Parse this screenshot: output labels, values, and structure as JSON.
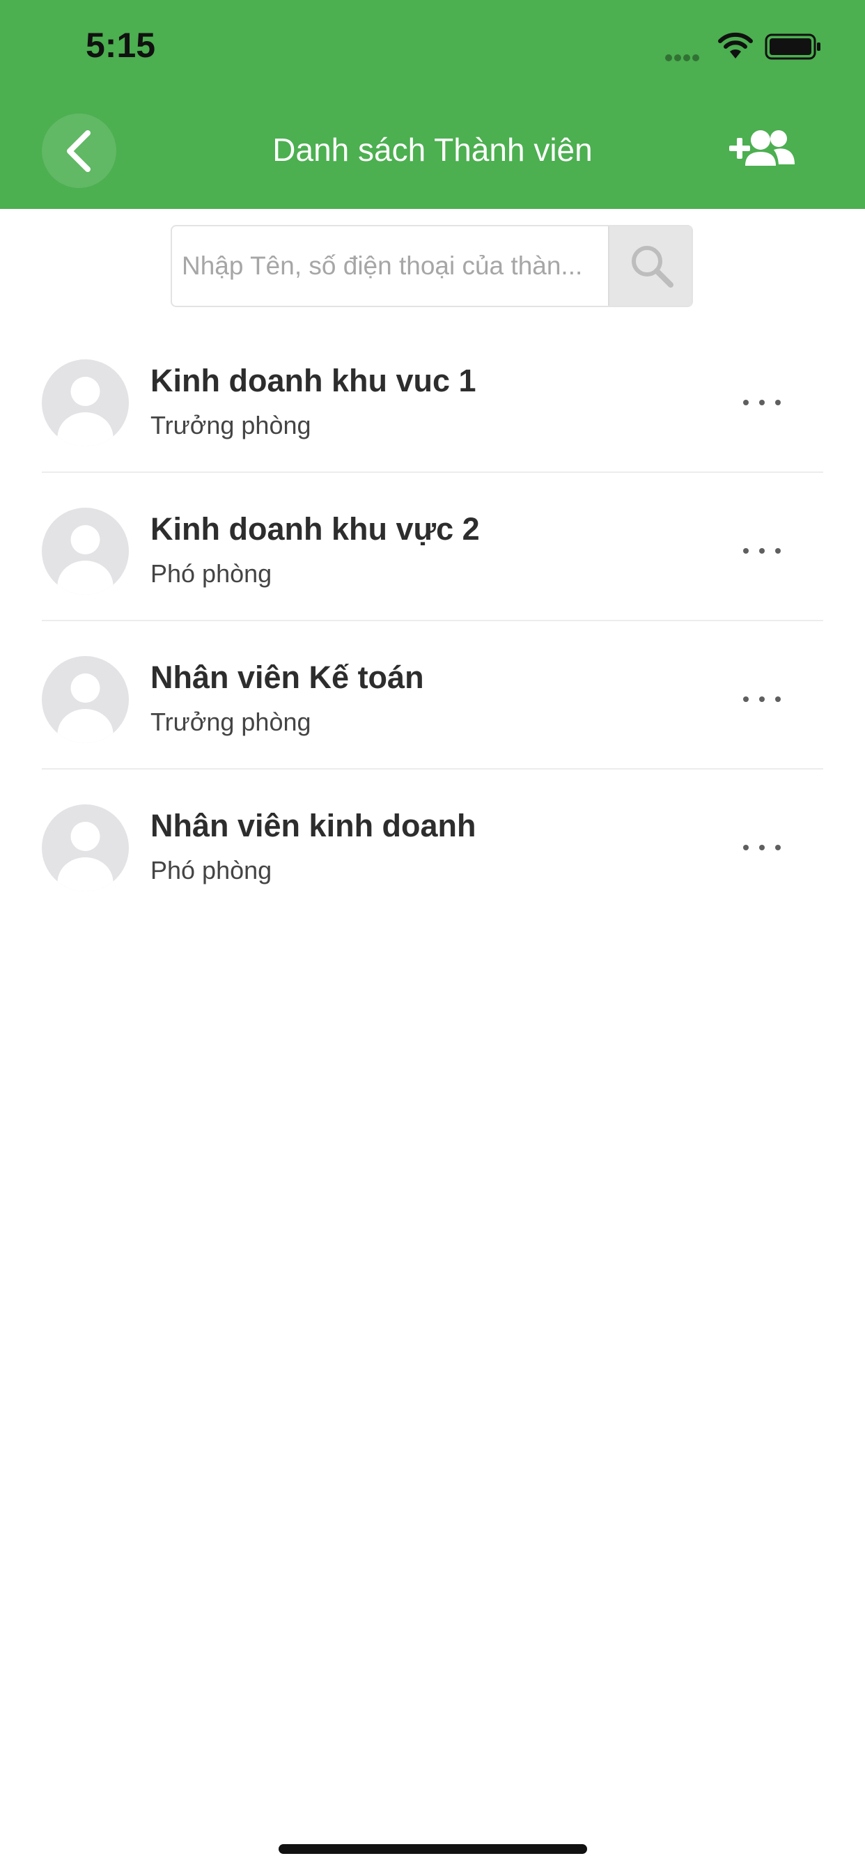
{
  "status_bar": {
    "time": "5:15"
  },
  "header": {
    "title": "Danh sách Thành viên",
    "back_icon": "chevron-left-icon",
    "add_icon": "add-user-icon",
    "color": "#4caf50"
  },
  "search": {
    "placeholder": "Nhập Tên, số điện thoại của thàn...",
    "value": "",
    "icon": "search-icon"
  },
  "members": [
    {
      "name": "Kinh doanh khu vuc 1",
      "role": "Trưởng phòng"
    },
    {
      "name": "Kinh doanh khu vực 2",
      "role": "Phó phòng"
    },
    {
      "name": "Nhân viên Kế toán",
      "role": "Trưởng phòng"
    },
    {
      "name": "Nhân viên kinh doanh",
      "role": "Phó phòng"
    }
  ]
}
